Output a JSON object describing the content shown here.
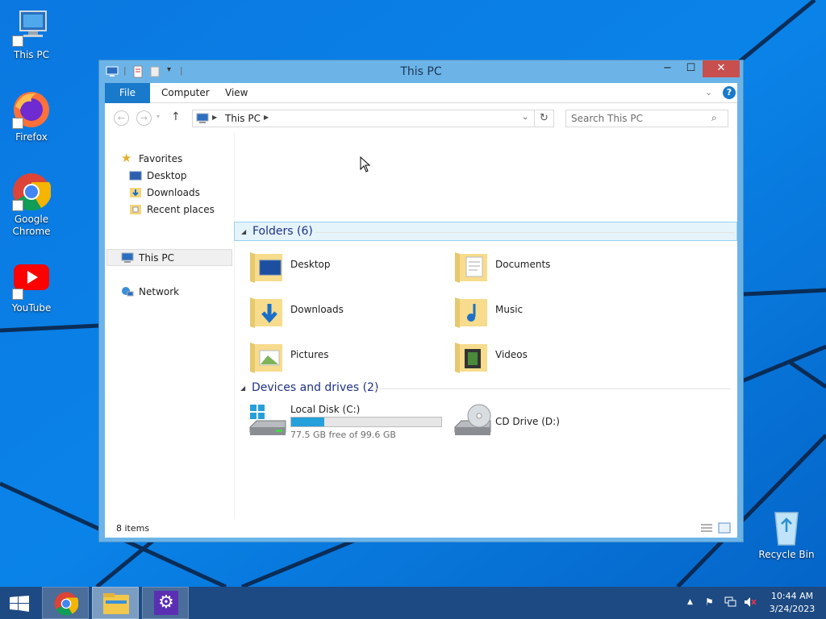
{
  "desktop": {
    "icons": [
      {
        "label": "This PC"
      },
      {
        "label": "Firefox"
      },
      {
        "label": "Google Chrome"
      },
      {
        "label": "YouTube"
      },
      {
        "label": "Recycle Bin"
      }
    ]
  },
  "window": {
    "title": "This PC",
    "controls": {
      "minimize": "−",
      "maximize": "☐",
      "close": "✕"
    },
    "ribbon": {
      "tabs": [
        "File",
        "Computer",
        "View"
      ]
    },
    "address": {
      "path": "This PC"
    },
    "search": {
      "placeholder": "Search This PC"
    },
    "nav_pane": {
      "favorites_label": "Favorites",
      "favorites": [
        "Desktop",
        "Downloads",
        "Recent places"
      ],
      "this_pc": "This PC",
      "network": "Network"
    },
    "content": {
      "folders_header": "Folders (6)",
      "folders": [
        "Desktop",
        "Documents",
        "Downloads",
        "Music",
        "Pictures",
        "Videos"
      ],
      "devices_header": "Devices and drives (2)",
      "drives": [
        {
          "name": "Local Disk (C:)",
          "free_text": "77.5 GB free of 99.6 GB",
          "used_fraction": 0.222
        },
        {
          "name": "CD Drive (D:)"
        }
      ]
    },
    "status": {
      "items": "8 items"
    }
  },
  "taskbar": {
    "time": "10:44 AM",
    "date": "3/24/2023"
  },
  "colors": {
    "accent": "#1979ca",
    "selection_bg": "#e5f3fb",
    "drive_bar": "#26a0da",
    "close_button": "#c7504f"
  }
}
